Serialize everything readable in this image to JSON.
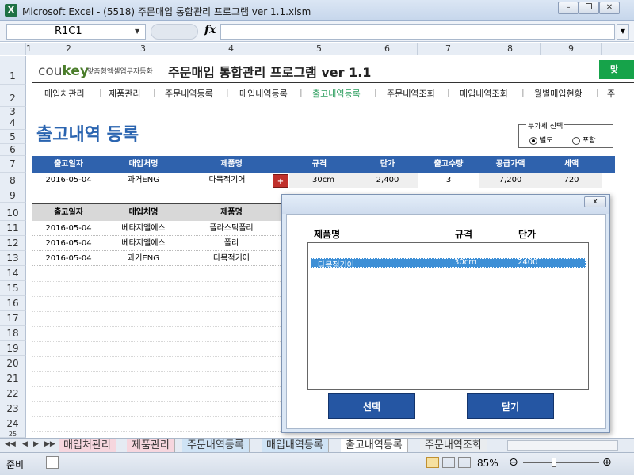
{
  "window": {
    "title": "Microsoft Excel - (5518) 주문매입 통합관리 프로그램 ver 1.1.xlsm",
    "app_icon": "X"
  },
  "formula": {
    "name_box": "R1C1",
    "fx": "fx",
    "value": ""
  },
  "columns": [
    "1",
    "2",
    "3",
    "4",
    "5",
    "6",
    "7",
    "8",
    "9"
  ],
  "rows": [
    "1",
    "2",
    "3",
    "4",
    "5",
    "6",
    "7",
    "8",
    "9",
    "10",
    "11",
    "12",
    "13",
    "14",
    "15",
    "16",
    "17",
    "18",
    "19",
    "20",
    "21",
    "22",
    "23",
    "24",
    "25"
  ],
  "header": {
    "logo_main": "cou",
    "logo_accent": "key",
    "logo_sub": "맞춤형엑셀업무자동화",
    "title": "주문매입 통합관리 프로그램 ver 1.1",
    "green_button": "맞"
  },
  "nav": [
    "매입처관리",
    "제품관리",
    "주문내역등록",
    "매입내역등록",
    "출고내역등록",
    "주문내역조회",
    "매입내역조회",
    "월별매입현황",
    "주"
  ],
  "nav_active": "출고내역등록",
  "page_title": "출고내역 등록",
  "vat": {
    "label": "부가세 선택",
    "options": [
      "별도",
      "포함"
    ],
    "selected": "별도"
  },
  "input_table": {
    "headers": [
      "출고일자",
      "매입처명",
      "제품명",
      "",
      "규격",
      "단가",
      "출고수량",
      "공급가액",
      "세액"
    ],
    "row": [
      "2016-05-04",
      "과거ENG",
      "다목적기어",
      "+",
      "30cm",
      "2,400",
      "3",
      "7,200",
      "720"
    ]
  },
  "list_table": {
    "headers": [
      "출고일자",
      "매입처명",
      "제품명"
    ],
    "rows": [
      [
        "2016-05-04",
        "베타지엘에스",
        "플라스틱폴리"
      ],
      [
        "2016-05-04",
        "베타지엘에스",
        "폴리"
      ],
      [
        "2016-05-04",
        "과거ENG",
        "다목적기어"
      ]
    ]
  },
  "dialog": {
    "close": "x",
    "headers": [
      "제품명",
      "규격",
      "단가"
    ],
    "selected_row": [
      "다목적기어",
      "30cm",
      "2400"
    ],
    "select_button": "선택",
    "close_button": "닫기"
  },
  "sheet_tabs": [
    "매입처관리",
    "제품관리",
    "주문내역등록",
    "매입내역등록",
    "출고내역등록",
    "주문내역조회"
  ],
  "active_tab": "출고내역등록",
  "status": {
    "ready": "준비",
    "zoom": "85%"
  }
}
